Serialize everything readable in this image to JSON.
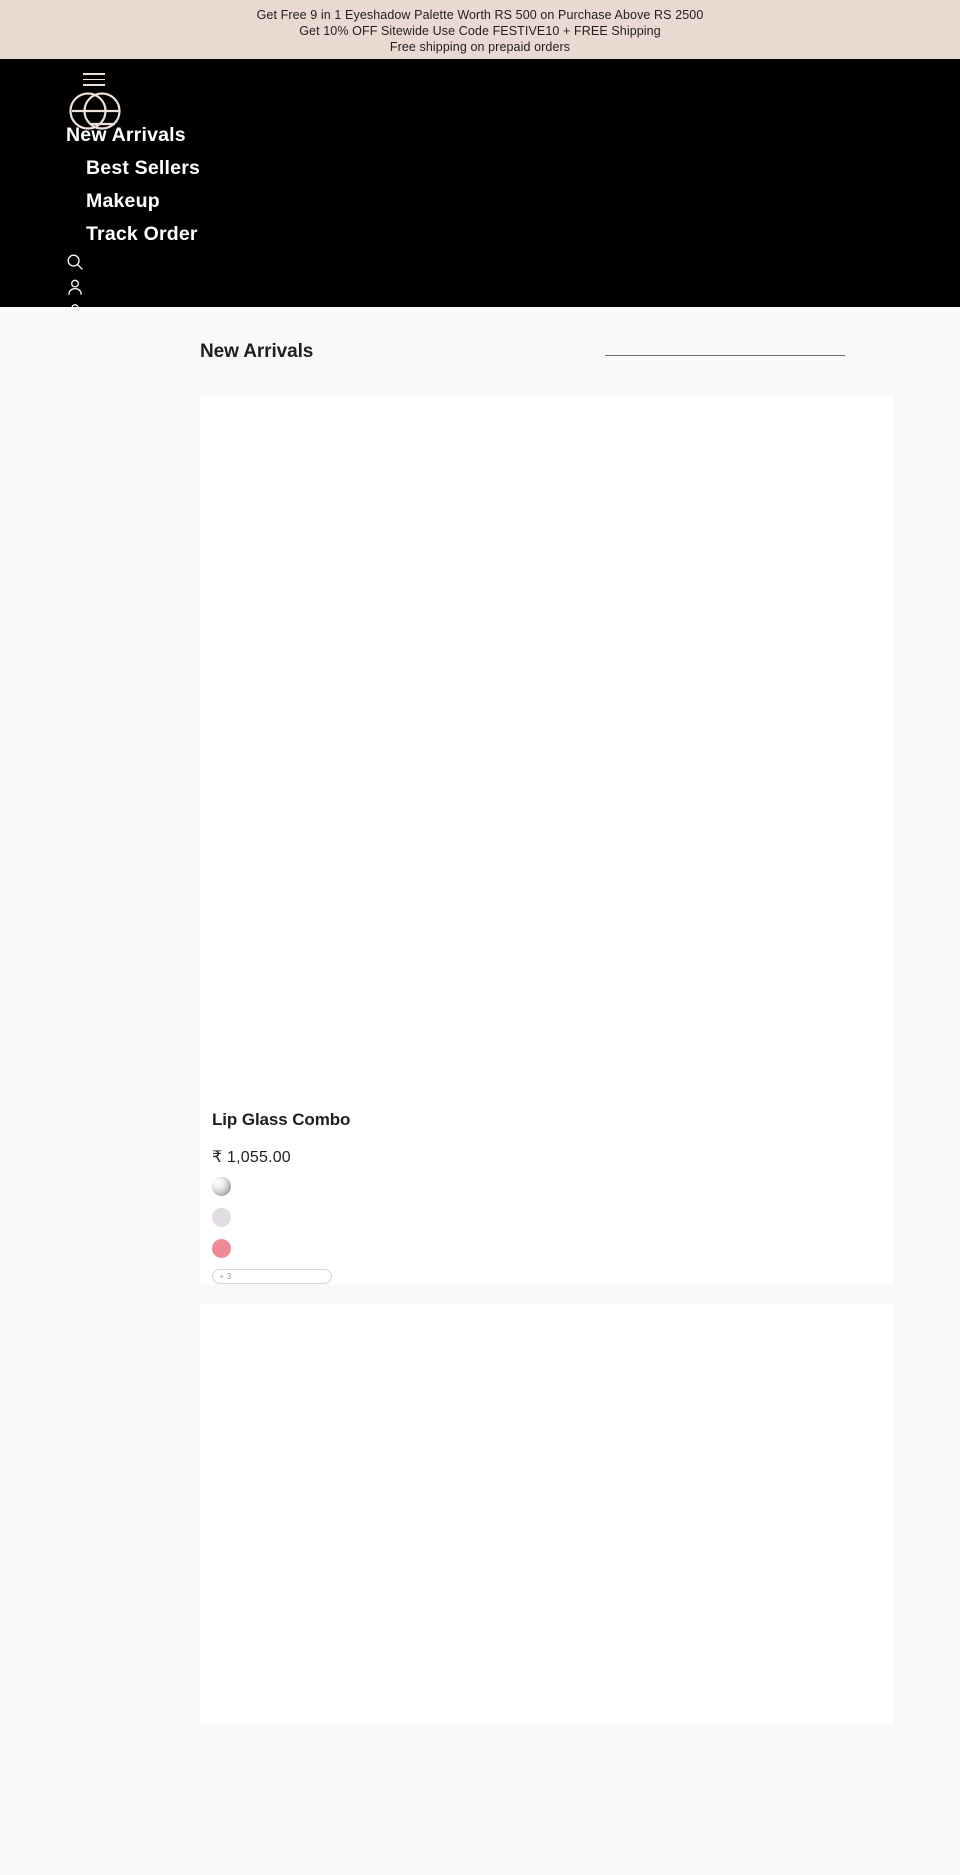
{
  "announcement": {
    "lines": [
      "Get Free 9 in 1 Eyeshadow Palette Worth RS 500 on Purchase Above RS 2500",
      "Get 10% OFF Sitewide Use Code FESTIVE10 + FREE Shipping",
      "Free shipping on prepaid orders"
    ],
    "background_color": "#ead9d1"
  },
  "header": {
    "background_color": "#000000",
    "logo": {
      "name": "cg-monogram-logo",
      "color": "#efe0d8"
    },
    "menu_icon": "hamburger-menu-icon",
    "nav": [
      {
        "label": "New Arrivals"
      },
      {
        "label": "Best Sellers"
      },
      {
        "label": "Makeup"
      },
      {
        "label": "Track Order"
      }
    ],
    "icons": [
      {
        "name": "search-icon"
      },
      {
        "name": "account-icon"
      },
      {
        "name": "cart-icon"
      }
    ]
  },
  "main": {
    "section": {
      "title": "New Arrivals"
    },
    "products": [
      {
        "title": "Lip Glass Combo",
        "price": "₹ 1,055.00",
        "swatches": [
          {
            "name": "swatch-image",
            "color": "#d3d3d3",
            "type": "image"
          },
          {
            "name": "swatch-lavender",
            "color": "#e0dce2",
            "type": "solid"
          },
          {
            "name": "swatch-rose",
            "color": "#ee8a96",
            "type": "solid"
          }
        ],
        "more_swatches_label": "+ 3"
      }
    ]
  },
  "theme": {
    "page_background": "#f9f9f9",
    "card_background": "#ffffff",
    "text_color": "#1f1f1f",
    "accent_color": "#ead9d1",
    "rule_color": "#6f6f6f"
  }
}
